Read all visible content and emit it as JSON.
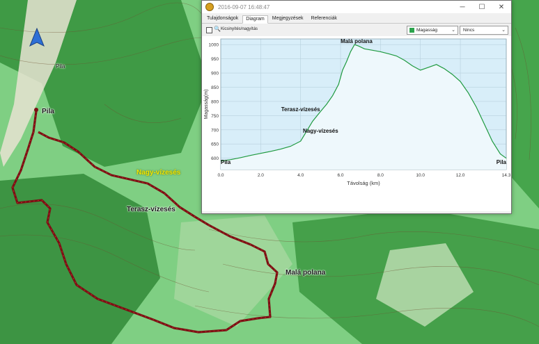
{
  "map": {
    "labels": {
      "pila_start": "Pila",
      "pila_top": "Pila",
      "nagy_vizeses": "Nagy-vízesés",
      "terasz_vizeses": "Terasz-vízesés",
      "mala_polana": "Malá polana"
    },
    "colors": {
      "track": "#7a1014",
      "forest": "#3f9a45",
      "grass": "#7fcf83"
    }
  },
  "window": {
    "title": "2016-09-07 16:48:47",
    "app_icon": "garmin-app-icon",
    "controls": {
      "minimize": "─",
      "maximize": "☐",
      "close": "✕"
    },
    "tabs": [
      {
        "label": "Tulajdonságok",
        "active": false
      },
      {
        "label": "Diagram",
        "active": true
      },
      {
        "label": "Megjegyzések",
        "active": false
      },
      {
        "label": "Referenciák",
        "active": false
      }
    ],
    "toolbar": {
      "zoom_label": "Kicsinyítés/nagyítás",
      "zoom_checked": false,
      "y_axis_select": "Magasság",
      "x_axis_select": "Nincs"
    }
  },
  "chart_data": {
    "type": "area",
    "xlabel": "Távolság (km)",
    "ylabel": "Magasság(m)",
    "xlim": [
      0,
      14.3
    ],
    "ylim": [
      560,
      1020
    ],
    "x_ticks": [
      "0.0",
      "2.0",
      "4.0",
      "6.0",
      "8.0",
      "10.0",
      "12.0",
      "14.3"
    ],
    "y_ticks": [
      "600",
      "650",
      "700",
      "750",
      "800",
      "850",
      "900",
      "950",
      "1000"
    ],
    "series": [
      {
        "x": [
          0,
          0.5,
          1.0,
          1.5,
          2.0,
          2.5,
          3.0,
          3.5,
          4.0,
          4.3,
          4.6,
          5.0,
          5.3,
          5.6,
          5.9,
          6.1,
          6.3,
          6.5,
          6.7,
          6.9,
          7.2,
          7.6,
          8.0,
          8.4,
          8.8,
          9.2,
          9.6,
          10.0,
          10.4,
          10.8,
          11.2,
          11.6,
          12.0,
          12.4,
          12.8,
          13.2,
          13.6,
          14.0,
          14.3
        ],
        "values": [
          590,
          595,
          602,
          610,
          617,
          624,
          632,
          642,
          660,
          695,
          730,
          765,
          790,
          820,
          860,
          910,
          940,
          975,
          1000,
          995,
          985,
          980,
          975,
          968,
          960,
          945,
          925,
          910,
          920,
          930,
          915,
          895,
          870,
          830,
          780,
          720,
          660,
          615,
          600
        ]
      }
    ],
    "annotations": [
      {
        "text": "Malá polana",
        "x": 6.8,
        "y": 1005
      },
      {
        "text": "Terasz-vízesés",
        "x": 4.0,
        "y": 765
      },
      {
        "text": "Nagy-vízesés",
        "x": 5.0,
        "y": 690
      },
      {
        "text": "Pila",
        "x": 0.0,
        "y": 580
      },
      {
        "text": "Pila",
        "x": 14.3,
        "y": 580
      }
    ],
    "colors": {
      "fill": "#d8eef9",
      "line": "#1f9a3f",
      "grid": "#b7d0dd"
    },
    "grid": true
  }
}
